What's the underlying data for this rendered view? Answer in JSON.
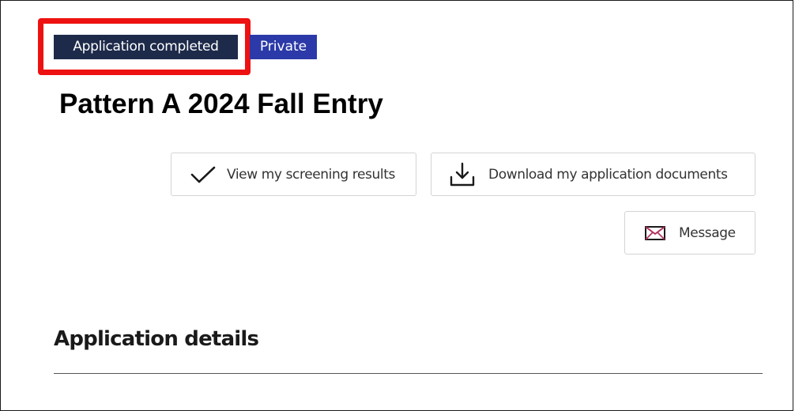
{
  "application": {
    "status_badge": "Application completed",
    "visibility_badge": "Private",
    "title": "Pattern A 2024 Fall Entry"
  },
  "actions": {
    "screening_results_label": "View my screening results",
    "download_documents_label": "Download my application documents",
    "message_label": "Message"
  },
  "icons": {
    "screening": "checkmark-icon",
    "download": "download-icon",
    "message": "envelope-icon"
  },
  "section": {
    "details_title": "Application details"
  },
  "colors": {
    "status_badge_bg": "#1d2a4a",
    "visibility_badge_bg": "#2b3aa8",
    "highlight": "#ee1111",
    "envelope_accent": "#b0305a"
  }
}
